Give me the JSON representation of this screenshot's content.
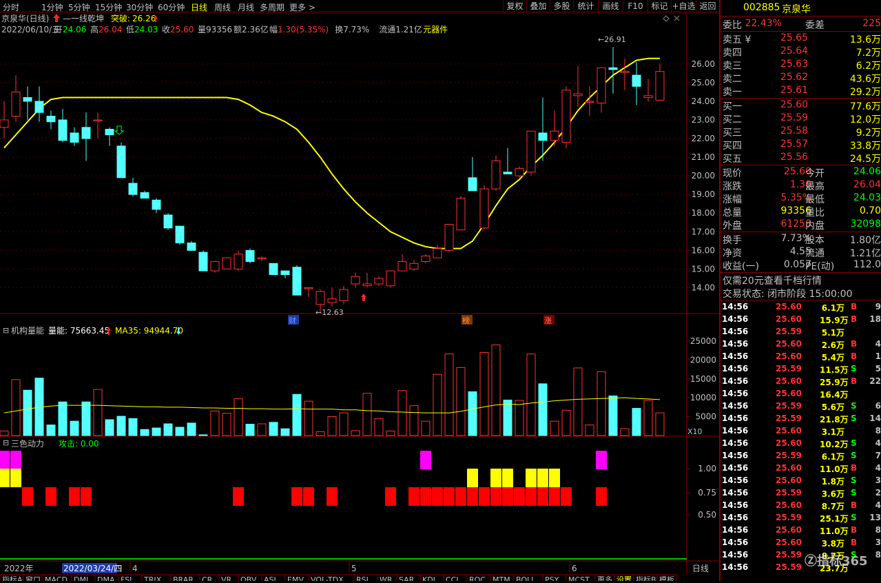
{
  "toolbar": {
    "periods": [
      "分时",
      "1分钟",
      "5分钟",
      "15分钟",
      "30分钟",
      "60分钟",
      "日线",
      "周线",
      "月线",
      "多周期",
      "更多 >"
    ],
    "active_period": "日线",
    "buttons": [
      "复权",
      "叠加",
      "多股",
      "统计",
      "画线",
      "F10",
      "标记",
      "+自选",
      "返回"
    ]
  },
  "info": {
    "stock": "京泉华(日线)",
    "signal": "一线乾坤",
    "breakout_label": "突破:",
    "breakout_value": "26.26",
    "date": "2022/06/10/五",
    "open_label": "开",
    "open": "24.06",
    "high_label": "高",
    "high": "26.04",
    "low_label": "低",
    "low": "24.03",
    "close_label": "收",
    "close": "25.60",
    "vol_label": "量",
    "vol": "93356",
    "amount_label": "额",
    "amount": "2.36亿",
    "amp_label": "幅",
    "amp": "1.30(5.35%)",
    "turn_label": "换",
    "turn": "7.73%",
    "float_label": "流通",
    "float": "1.21亿",
    "tool": "元器件",
    "high_mark": "26.91",
    "low_mark": "12.63",
    "badges": [
      "财",
      "榜",
      "涨"
    ]
  },
  "price_axis": [
    "26.00",
    "25.00",
    "24.00",
    "23.00",
    "22.00",
    "21.00",
    "20.00",
    "19.00",
    "18.00",
    "17.00",
    "16.00",
    "15.00",
    "14.00"
  ],
  "volume_panel": {
    "title": "机构量能",
    "line1_label": "量能:",
    "line1_value": "75663.45",
    "line2_label": "MA35:",
    "line2_value": "94944.70",
    "axis": [
      "25000",
      "20000",
      "15000",
      "10000",
      "5000"
    ],
    "unit": "X10"
  },
  "power_panel": {
    "title": "三色动力",
    "attack_label": "攻击:",
    "attack_value": "0.00",
    "axis": [
      "1.00",
      "0.75",
      "0.50"
    ]
  },
  "xaxis": {
    "year": "2022年",
    "cursor_date": "2022/03/24/四",
    "months": [
      "4",
      "5",
      "6"
    ],
    "mode": "日线"
  },
  "bottom_tabs": [
    "指标A",
    "窗口",
    "MACD",
    "DMI",
    "DMA",
    "FSL",
    "TRIX",
    "BRAR",
    "CR",
    "VR",
    "OBV",
    "ASI",
    "EMV",
    "VOL-TDX",
    "RSI",
    "WR",
    "SAR",
    "KDJ",
    "CCI",
    "ROC",
    "MTM",
    "BOLL",
    "PSY",
    "MCST",
    "更多",
    "设置",
    "指标B",
    "模板"
  ],
  "chart_data": {
    "type": "candlestick",
    "ohlc": [
      [
        22.6,
        24,
        22,
        23
      ],
      [
        23.2,
        25.4,
        22.9,
        24.5
      ],
      [
        24.2,
        24.8,
        23,
        24
      ],
      [
        24,
        24.8,
        22.9,
        23.4
      ],
      [
        23.2,
        23.5,
        22.5,
        22.9
      ],
      [
        23,
        23.6,
        21.8,
        21.9
      ],
      [
        22.3,
        22.6,
        21.6,
        21.8
      ],
      [
        22.6,
        23.4,
        20.8,
        22
      ],
      [
        23,
        23.4,
        22,
        23
      ],
      [
        22.5,
        22.6,
        21.6,
        22.2
      ],
      [
        21.6,
        21.8,
        19.9,
        19.9
      ],
      [
        19.6,
        19.9,
        18.9,
        19
      ],
      [
        19.1,
        19.2,
        18.8,
        18.8
      ],
      [
        18.7,
        18.8,
        18,
        18.2
      ],
      [
        17.9,
        18,
        17.1,
        17.2
      ],
      [
        17.3,
        17.3,
        16.3,
        16.4
      ],
      [
        16.4,
        16.5,
        16,
        16
      ],
      [
        15.9,
        16,
        14.9,
        14.9
      ],
      [
        14.9,
        15.4,
        14.8,
        15.4
      ],
      [
        15,
        15.6,
        15,
        15.6
      ],
      [
        15,
        16,
        14.9,
        15.8
      ],
      [
        16,
        16.1,
        15.3,
        15.4
      ],
      [
        15.6,
        15.7,
        15.4,
        15.6
      ],
      [
        15.3,
        15.3,
        14.7,
        14.7
      ],
      [
        14.9,
        14.9,
        14.5,
        14.7
      ],
      [
        15.1,
        15.2,
        13.6,
        13.6
      ],
      [
        14,
        14,
        13.5,
        14
      ],
      [
        13.1,
        13.9,
        12.63,
        13.8
      ],
      [
        13.2,
        14,
        13,
        13.4
      ],
      [
        13.3,
        14.1,
        13.1,
        13.9
      ],
      [
        14.2,
        14.8,
        14,
        14.6
      ],
      [
        14.1,
        14.8,
        14,
        14.2
      ],
      [
        14.2,
        14.6,
        14.1,
        14.5
      ],
      [
        14.1,
        14.8,
        14,
        14.9
      ],
      [
        14.9,
        15.8,
        14.9,
        15.4
      ],
      [
        15,
        15.5,
        14.9,
        15.3
      ],
      [
        15.4,
        15.8,
        15.3,
        15.7
      ],
      [
        15.6,
        16.3,
        15.6,
        16.1
      ],
      [
        16,
        17.3,
        15.9,
        17.4
      ],
      [
        17.1,
        18.9,
        17.1,
        18.8
      ],
      [
        19.9,
        21,
        19.2,
        19.2
      ],
      [
        17.2,
        19.5,
        17.1,
        19.3
      ],
      [
        19.3,
        21.1,
        19.2,
        20.8
      ],
      [
        20.2,
        21.5,
        20.1,
        20.1
      ],
      [
        20,
        20.5,
        19.9,
        20.4
      ],
      [
        20.2,
        22,
        20,
        22.4
      ],
      [
        22.3,
        24.2,
        20.8,
        21.9
      ],
      [
        21.9,
        23.5,
        21.6,
        22.4
      ],
      [
        21.8,
        24.8,
        21.5,
        24.6
      ],
      [
        24.3,
        25.9,
        23.7,
        24.4
      ],
      [
        24,
        24.8,
        23.2,
        24
      ],
      [
        23.9,
        25.8,
        23.4,
        25.8
      ],
      [
        25.8,
        26.91,
        24.4,
        25.7
      ],
      [
        25.6,
        26.3,
        24.6,
        25.6
      ],
      [
        25.4,
        26.1,
        23.8,
        24.8
      ],
      [
        24.2,
        25.2,
        24,
        24.3
      ],
      [
        24.06,
        26.04,
        24.03,
        25.6
      ]
    ],
    "volume": [
      1200,
      14800,
      12000,
      15200,
      2800,
      8900,
      3800,
      8900,
      12200,
      4200,
      5100,
      4500,
      1600,
      2000,
      3100,
      2200,
      3300,
      200,
      6500,
      5900,
      9800,
      3000,
      3100,
      3500,
      1800,
      10900,
      9100,
      1000,
      5000,
      6000,
      1300,
      11200,
      4500,
      1200,
      11900,
      7900,
      3800,
      16200,
      21600,
      18000,
      11600,
      22000,
      24000,
      9400,
      9300,
      21600,
      13700,
      3800,
      6700,
      17900,
      2800,
      16900,
      10500,
      1800,
      7200,
      9300,
      6000
    ],
    "ma": [
      21.5,
      22.2,
      22.9,
      23.6,
      24.1,
      24.2,
      24.2,
      24.2,
      24.2,
      24.2,
      24.2,
      24.2,
      24.2,
      24.2,
      24.2,
      24.2,
      24.2,
      24.2,
      24.2,
      24.2,
      24.1,
      23.8,
      23.4,
      23.2,
      22.9,
      22.5,
      21.8,
      21,
      20.1,
      19.3,
      18.6,
      18,
      17.5,
      17,
      16.7,
      16.4,
      16.2,
      16.1,
      16.1,
      16.1,
      16.5,
      17.4,
      18.4,
      19.3,
      19.8,
      20.5,
      21.1,
      21.8,
      22.6,
      23.5,
      24.2,
      24.8,
      25.4,
      25.8,
      26.2,
      26.3,
      26.3
    ],
    "vol_ma": [
      6000,
      6500,
      7000,
      7500,
      7800,
      8000,
      8000,
      8000,
      8000,
      7900,
      7800,
      7700,
      7600,
      7600,
      7500,
      7500,
      7400,
      7300,
      7300,
      7200,
      7200,
      7100,
      7100,
      7000,
      7000,
      7100,
      7000,
      7000,
      7000,
      6800,
      6800,
      6600,
      6500,
      6300,
      6200,
      6100,
      6000,
      6000,
      6000,
      6400,
      7000,
      7600,
      8100,
      8300,
      8200,
      8600,
      8900,
      9200,
      9400,
      9600,
      9700,
      9800,
      9900,
      10000,
      9800,
      9700,
      9500
    ],
    "power": [
      [
        2,
        3
      ],
      [
        2,
        3
      ],
      [
        1
      ],
      [
        0
      ],
      [
        1
      ],
      [
        0
      ],
      [
        1
      ],
      [
        1
      ],
      [
        0
      ],
      [
        0
      ],
      [
        0
      ],
      [
        0
      ],
      [
        0
      ],
      [
        0
      ],
      [
        0
      ],
      [
        0
      ],
      [
        0
      ],
      [
        0
      ],
      [
        0
      ],
      [
        0
      ],
      [
        1
      ],
      [
        0
      ],
      [
        0
      ],
      [
        0
      ],
      [
        0
      ],
      [
        1
      ],
      [
        1
      ],
      [
        0
      ],
      [
        1
      ],
      [
        0
      ],
      [
        0
      ],
      [
        0
      ],
      [
        0
      ],
      [
        1
      ],
      [
        0
      ],
      [
        1
      ],
      [
        2,
        1
      ],
      [
        1
      ],
      [
        1
      ],
      [
        1
      ],
      [
        3,
        1
      ],
      [
        1
      ],
      [
        3,
        1
      ],
      [
        3,
        1
      ],
      [
        1
      ],
      [
        3,
        1
      ],
      [
        3,
        1
      ],
      [
        3,
        1
      ],
      [
        1
      ],
      [
        0
      ],
      [
        0
      ],
      [
        2,
        1
      ],
      [
        0
      ],
      [
        0
      ],
      [
        0
      ],
      [
        0
      ],
      [
        0
      ]
    ],
    "ylim": [
      12.5,
      27.4
    ],
    "vol_ylim": [
      0,
      27000
    ]
  },
  "right": {
    "code": "002885",
    "name": "京泉华",
    "weibi_label": "委比",
    "weibi": "22.43%",
    "weicha_label": "委差",
    "weicha": "225",
    "asks": [
      [
        "卖五 ¥",
        "25.65",
        "13.6万"
      ],
      [
        "卖四",
        "25.64",
        "7.2万"
      ],
      [
        "卖三",
        "25.63",
        "6.2万"
      ],
      [
        "卖二",
        "25.62",
        "43.6万"
      ],
      [
        "卖一",
        "25.61",
        "29.2万"
      ]
    ],
    "bids": [
      [
        "买一",
        "25.60",
        "77.6万"
      ],
      [
        "买二",
        "25.59",
        "12.0万"
      ],
      [
        "买三",
        "25.58",
        "9.2万"
      ],
      [
        "买四",
        "25.57",
        "33.8万"
      ],
      [
        "买五",
        "25.56",
        "24.5万"
      ]
    ],
    "stats": [
      [
        "现价",
        "25.60",
        "今开",
        "24.06"
      ],
      [
        "涨跌",
        "1.30",
        "最高",
        "26.04"
      ],
      [
        "涨幅",
        "5.35%",
        "最低",
        "24.03"
      ],
      [
        "总量",
        "93356",
        "量比",
        "0.70"
      ],
      [
        "外盘",
        "61258",
        "内盘",
        "32098"
      ]
    ],
    "stats2": [
      [
        "换手",
        "7.73%",
        "股本",
        "1.80亿"
      ],
      [
        "净资",
        "4.55",
        "流通",
        "1.21亿"
      ],
      [
        "收益(一)",
        "0.057",
        "PE(动)",
        "112.0"
      ]
    ],
    "promo": "仅需20元查看千档行情",
    "status": "交易状态: 闭市阶段 15:00:00",
    "trades": [
      [
        "14:56",
        "25.60",
        "6.1万",
        "B",
        "9"
      ],
      [
        "14:56",
        "25.60",
        "15.9万",
        "B",
        "18"
      ],
      [
        "14:56",
        "25.59",
        "5.1万",
        "",
        ""
      ],
      [
        "14:56",
        "25.60",
        "2.6万",
        "B",
        "4"
      ],
      [
        "14:56",
        "25.60",
        "5.4万",
        "B",
        "1"
      ],
      [
        "14:56",
        "25.59",
        "11.5万",
        "S",
        "5"
      ],
      [
        "14:56",
        "25.60",
        "25.9万",
        "B",
        "22"
      ],
      [
        "14:56",
        "25.60",
        "16.4万",
        "",
        ""
      ],
      [
        "14:56",
        "25.59",
        "5.6万",
        "S",
        "6"
      ],
      [
        "14:56",
        "25.59",
        "21.8万",
        "S",
        "14"
      ],
      [
        "14:56",
        "25.60",
        "3.1万",
        "",
        "8"
      ],
      [
        "14:56",
        "25.60",
        "10.2万",
        "S",
        "4"
      ],
      [
        "14:56",
        "25.59",
        "6.1万",
        "S",
        "7"
      ],
      [
        "14:56",
        "25.60",
        "11.0万",
        "B",
        "4"
      ],
      [
        "14:56",
        "25.60",
        "1.8万",
        "S",
        "3"
      ],
      [
        "14:56",
        "25.59",
        "3.6万",
        "S",
        "2"
      ],
      [
        "14:56",
        "25.60",
        "8.7万",
        "B",
        "4"
      ],
      [
        "14:56",
        "25.59",
        "25.1万",
        "S",
        "13"
      ],
      [
        "14:56",
        "25.60",
        "11.0万",
        "B",
        "8"
      ],
      [
        "14:56",
        "25.60",
        "3.8万",
        "B",
        "3"
      ],
      [
        "14:56",
        "25.59",
        "8.7万",
        "S",
        "8"
      ],
      [
        "14:56",
        "25.59",
        "23.7万",
        "",
        ""
      ]
    ],
    "watermark": "指标365"
  }
}
